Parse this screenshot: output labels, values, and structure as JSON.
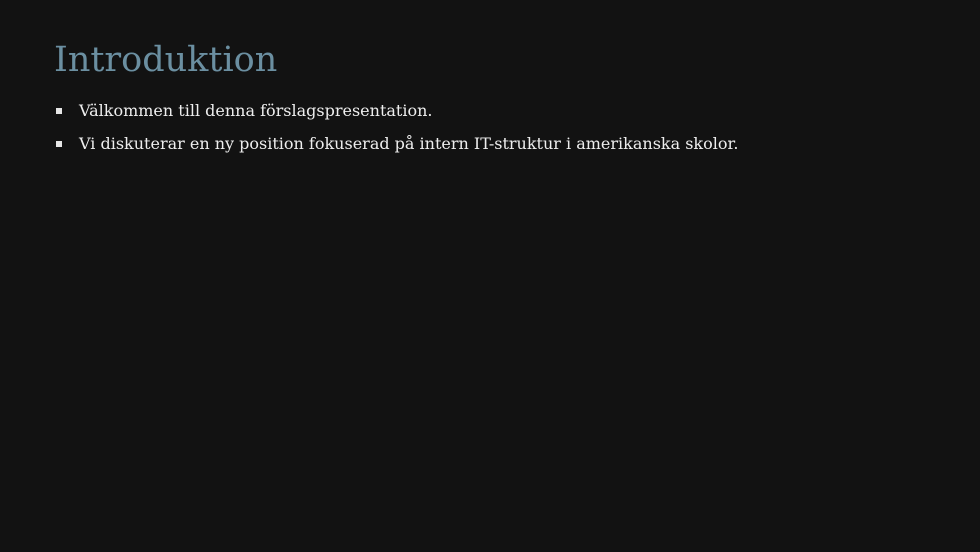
{
  "slide": {
    "title": "Introduktion",
    "bullets": [
      "Välkommen till denna förslagspresentation.",
      "Vi diskuterar en ny position fokuserad på intern IT-struktur i amerikanska skolor."
    ]
  },
  "colors": {
    "background": "#121212",
    "title": "#6b8fa1",
    "text": "#eeeeee"
  }
}
